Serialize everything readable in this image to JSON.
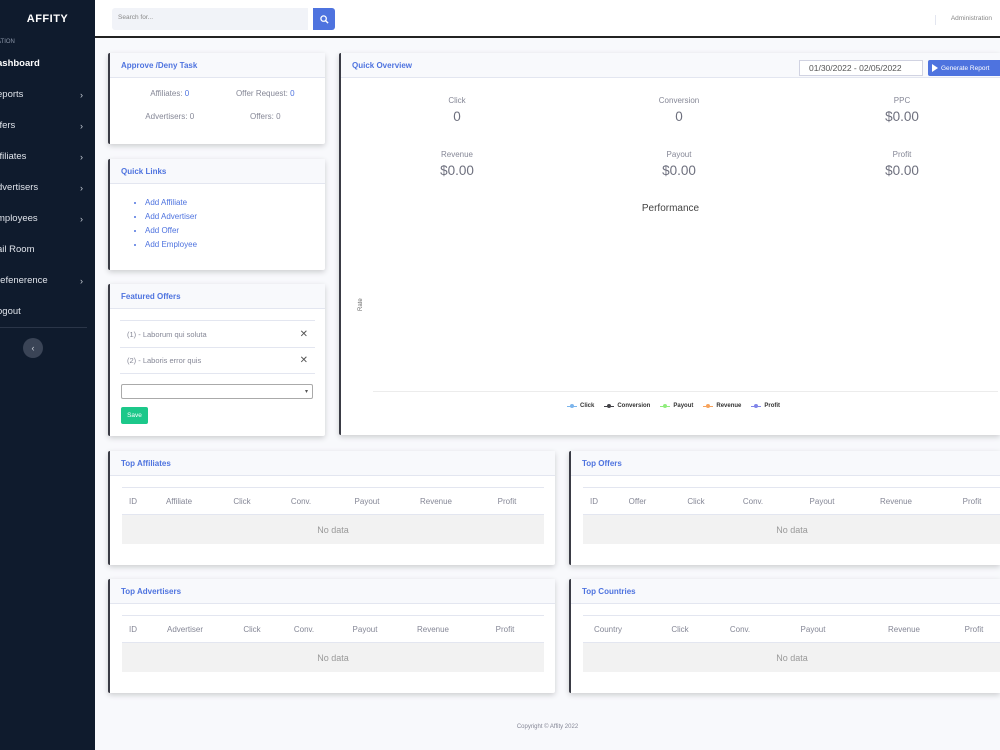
{
  "sidebar": {
    "brand": "AFFITY",
    "heading": "ATION",
    "items": [
      {
        "label": "ashboard",
        "chevron": ""
      },
      {
        "label": "eports",
        "chevron": "›"
      },
      {
        "label": "ffers",
        "chevron": "›"
      },
      {
        "label": "ffiliates",
        "chevron": "›"
      },
      {
        "label": "dvertisers",
        "chevron": "›"
      },
      {
        "label": "mployees",
        "chevron": "›"
      },
      {
        "label": "ail Room",
        "chevron": ""
      },
      {
        "label": "refenerence",
        "chevron": "›"
      },
      {
        "label": "ogout",
        "chevron": ""
      }
    ],
    "collapse_icon": "‹"
  },
  "topbar": {
    "search_placeholder": "Search for...",
    "user_label": "Administration"
  },
  "approve": {
    "title": "Approve /Deny Task",
    "affiliates_label": "Affiliates:",
    "affiliates_value": "0",
    "offer_request_label": "Offer Request:",
    "offer_request_value": "0",
    "advertisers_label": "Advertisers:",
    "advertisers_value": "0",
    "offers_label": "Offers:",
    "offers_value": "0"
  },
  "quick_links": {
    "title": "Quick Links",
    "items": [
      "Add Affiliate",
      "Add Advertiser",
      "Add Offer",
      "Add Employee"
    ]
  },
  "featured": {
    "title": "Featured Offers",
    "items": [
      "(1) - Laborum qui soluta",
      "(2) - Laboris error quis"
    ],
    "remove_icon": "✕",
    "select_value": "",
    "select_arrow": "▾",
    "save_label": "Save"
  },
  "overview": {
    "title": "Quick Overview",
    "date_range": "01/30/2022 - 02/05/2022",
    "generate_label": "Generate Report",
    "stats": [
      {
        "label": "Click",
        "value": "0"
      },
      {
        "label": "Conversion",
        "value": "0"
      },
      {
        "label": "PPC",
        "value": "$0.00"
      },
      {
        "label": "Revenue",
        "value": "$0.00"
      },
      {
        "label": "Payout",
        "value": "$0.00"
      },
      {
        "label": "Profit",
        "value": "$0.00"
      }
    ],
    "chart_title": "Performance",
    "y_label": "Rate",
    "legend": [
      {
        "name": "Click",
        "color": "#7cb5ec"
      },
      {
        "name": "Conversion",
        "color": "#434348"
      },
      {
        "name": "Payout",
        "color": "#90ed7d"
      },
      {
        "name": "Revenue",
        "color": "#f7a35c"
      },
      {
        "name": "Profit",
        "color": "#8085e9"
      }
    ]
  },
  "top_affiliates": {
    "title": "Top Affiliates",
    "columns": [
      "ID",
      "Affiliate",
      "Click",
      "Conv.",
      "Payout",
      "Revenue",
      "Profit"
    ],
    "empty": "No data"
  },
  "top_offers": {
    "title": "Top Offers",
    "columns": [
      "ID",
      "Offer",
      "Click",
      "Conv.",
      "Payout",
      "Revenue",
      "Profit"
    ],
    "empty": "No data"
  },
  "top_advertisers": {
    "title": "Top Advertisers",
    "columns": [
      "ID",
      "Advertiser",
      "Click",
      "Conv.",
      "Payout",
      "Revenue",
      "Profit"
    ],
    "empty": "No data"
  },
  "top_countries": {
    "title": "Top Countries",
    "columns": [
      "Country",
      "Click",
      "Conv.",
      "Payout",
      "Revenue",
      "Profit"
    ],
    "empty": "No data"
  },
  "footer": {
    "text": "Copyright © Affity 2022"
  }
}
